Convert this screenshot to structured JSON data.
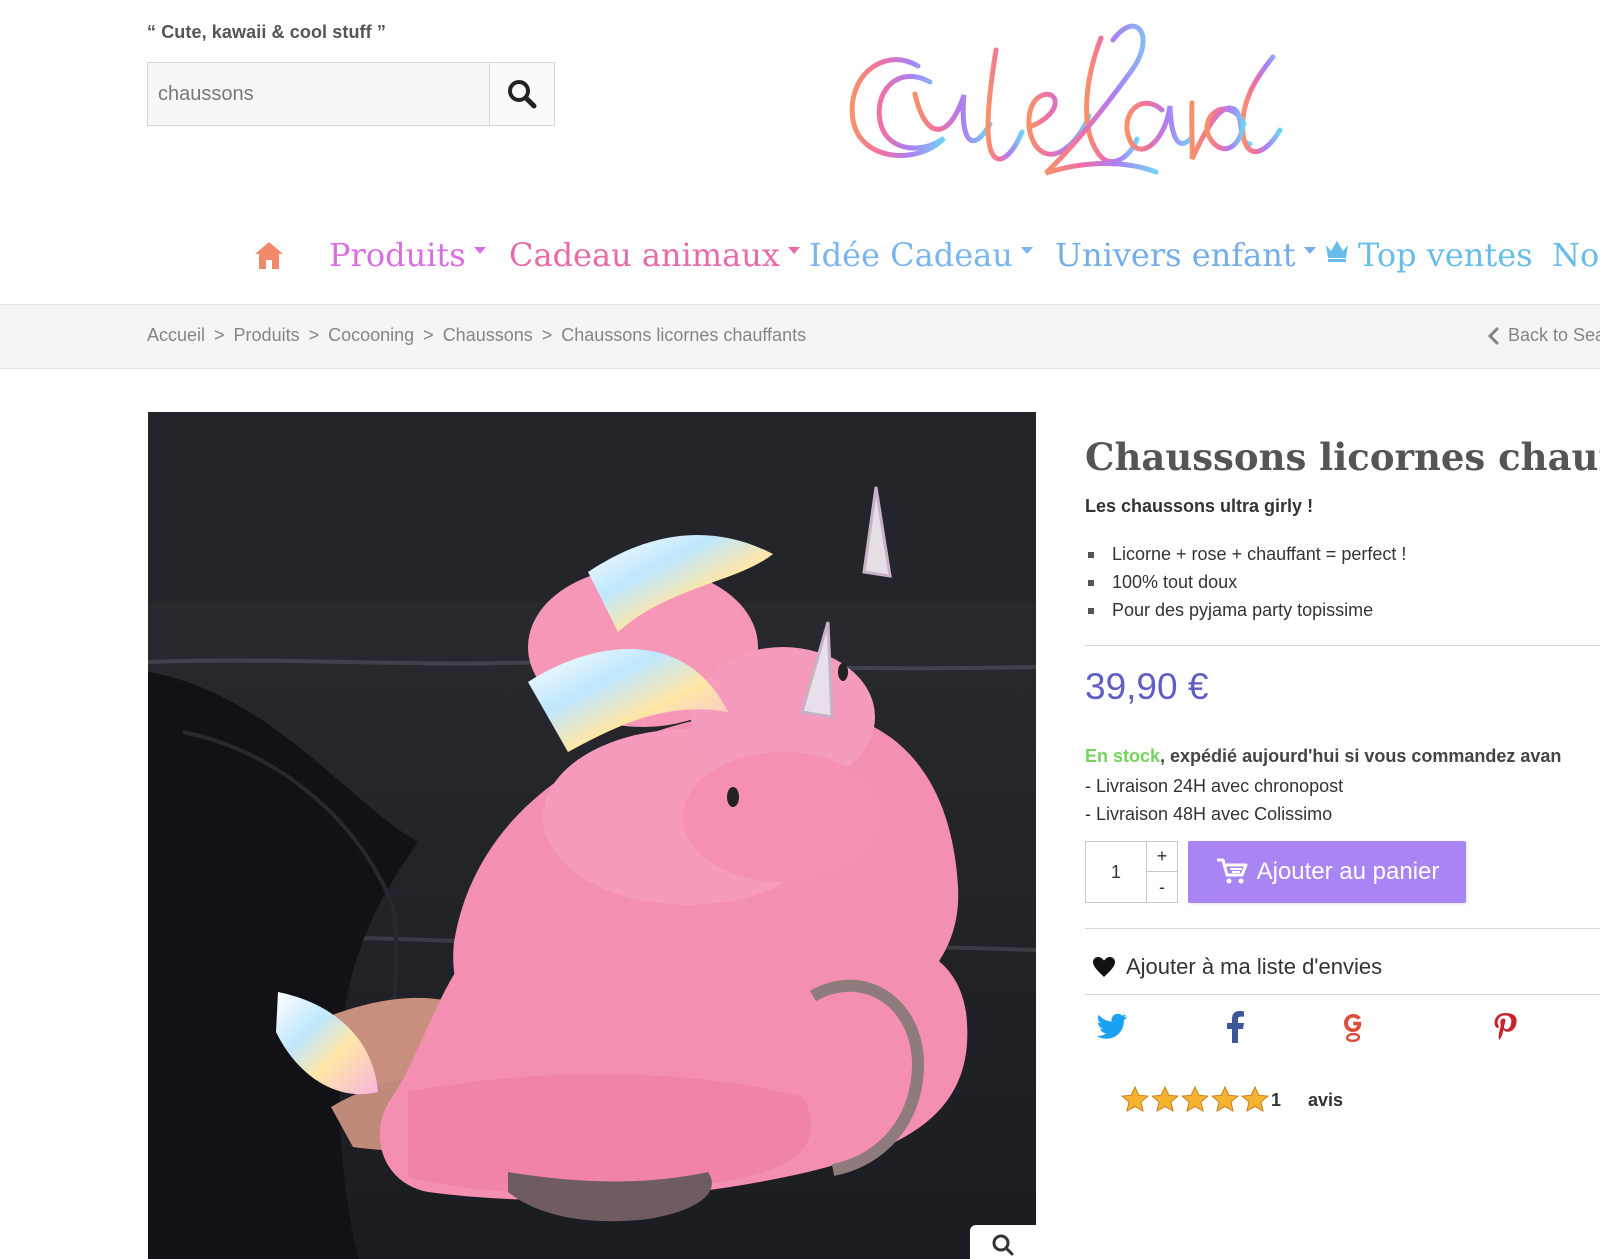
{
  "header": {
    "tagline": "“ Cute, kawaii & cool stuff ”",
    "search": {
      "value": "chaussons",
      "placeholder": "chaussons"
    },
    "logo_text": "CuteLand"
  },
  "nav": {
    "items": [
      {
        "label": "Produits",
        "icon": "dropdown-caret",
        "color": "#d86fe0"
      },
      {
        "label": "Cadeau animaux",
        "icon": "dropdown-caret",
        "color": "#e86aa8"
      },
      {
        "label": "Idée Cadeau",
        "icon": "dropdown-caret",
        "color": "#7ab6ee"
      },
      {
        "label": "Univers enfant",
        "icon": "dropdown-caret",
        "color": "#74aee9"
      },
      {
        "label": "Top ventes",
        "icon": "crown-icon",
        "color": "#68bde8"
      },
      {
        "label": "No",
        "icon": "",
        "color": "#68bde8"
      }
    ],
    "home_icon": "home-icon",
    "home_color": "#f08a6b"
  },
  "breadcrumb": {
    "items": [
      "Accueil",
      "Produits",
      "Cocooning",
      "Chaussons",
      "Chaussons licornes chauffants"
    ],
    "separator": ">",
    "back_label": "Back to Sea"
  },
  "product": {
    "title": "Chaussons licornes chauffants",
    "short_heading": "Les chaussons ultra girly !",
    "features": [
      "Licorne + rose + chauffant = perfect !",
      "100% tout doux",
      "Pour des pyjama party topissime"
    ],
    "price": "39,90 €",
    "stock": {
      "status": "En stock",
      "message": ", expédié aujourd'hui si vous commandez avan"
    },
    "delivery": [
      "- Livraison 24H avec chronopost",
      "- Livraison 48H avec Colissimo"
    ],
    "quantity": "1",
    "qty_plus": "+",
    "qty_minus": "-",
    "add_to_cart": "Ajouter au panier",
    "wishlist": "Ajouter à ma liste d'envies",
    "social": [
      "twitter-icon",
      "facebook-icon",
      "google-plus-icon",
      "pinterest-icon"
    ],
    "rating": {
      "stars": 5,
      "count": "1",
      "label": "avis"
    },
    "image_icon": "unicorn-slippers-photo"
  },
  "colors": {
    "price": "#5e5ec6",
    "stock_green": "#74d45f",
    "cart_button": "#a985f4",
    "pinterest": "#c8232c",
    "google_plus": "#dd4b39",
    "twitter": "#1da1f2",
    "facebook": "#3b5998",
    "star": "#f6b332"
  }
}
